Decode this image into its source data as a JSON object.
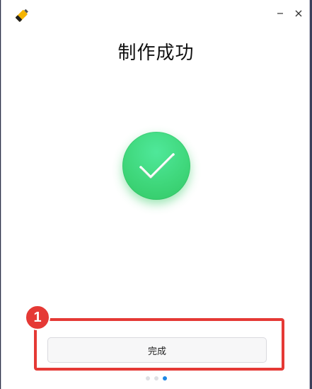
{
  "window": {
    "title": "制作成功",
    "app_icon": "usb-drive-icon",
    "minimize_icon": "minimize-icon",
    "close_icon": "close-icon"
  },
  "status": {
    "icon": "success-check-icon",
    "color": "#3fd77b"
  },
  "actions": {
    "done_label": "完成"
  },
  "annotation": {
    "number": "1",
    "color": "#e53935"
  },
  "pagination": {
    "total": 3,
    "current": 3,
    "active_color": "#1e88e5"
  }
}
